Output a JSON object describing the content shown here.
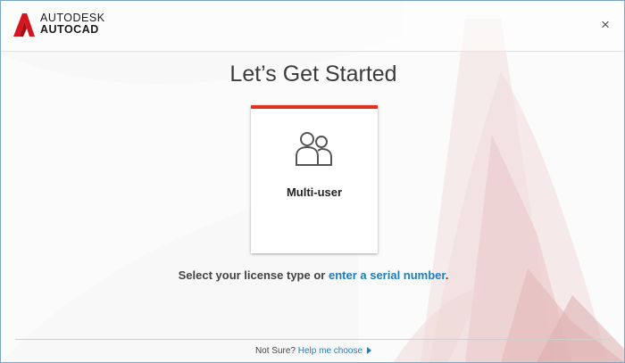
{
  "app": {
    "brand_company": "AUTODESK",
    "brand_product": "AUTOCAD",
    "logo_icon": "autocad-a-logo",
    "close_glyph": "×"
  },
  "main": {
    "title": "Let’s Get Started",
    "options": [
      {
        "label": "Multi-user",
        "icon": "multi-user-icon",
        "selected": true
      }
    ],
    "prompt_prefix": "Select your license type or ",
    "prompt_link": "enter a serial number",
    "prompt_suffix": "."
  },
  "footer": {
    "question": "Not Sure? ",
    "link": "Help me choose"
  },
  "colors": {
    "accent": "#e0301e",
    "link": "#1a7fc1"
  }
}
